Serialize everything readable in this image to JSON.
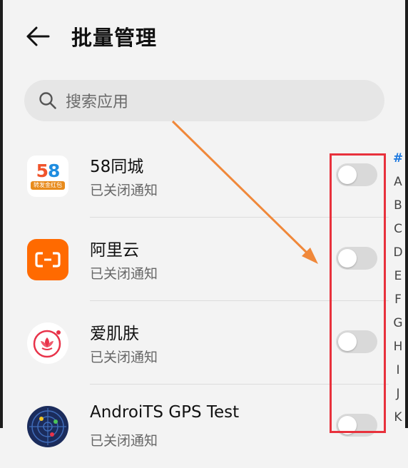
{
  "header": {
    "title": "批量管理",
    "back_icon": "arrow-left-icon"
  },
  "search": {
    "placeholder": "搜索应用",
    "icon": "search-icon"
  },
  "apps": [
    {
      "name": "58同城",
      "status": "已关闭通知",
      "icon": "58-tongcheng-logo",
      "icon_text": "58",
      "icon_tag": "转发金红包",
      "notifications_on": false
    },
    {
      "name": "阿里云",
      "status": "已关闭通知",
      "icon": "aliyun-logo",
      "notifications_on": false
    },
    {
      "name": "爱肌肤",
      "status": "已关闭通知",
      "icon": "aijifu-lotus-logo",
      "notifications_on": false
    },
    {
      "name": "AndroiTS GPS Test",
      "status": "已关闭通知",
      "icon": "gps-radar-logo",
      "notifications_on": false
    }
  ],
  "index_letters": [
    "#",
    "A",
    "B",
    "C",
    "D",
    "E",
    "F",
    "G",
    "H",
    "I",
    "J",
    "K"
  ],
  "active_letter": "#",
  "colors": {
    "accent": "#1f7ae0",
    "highlight_box": "#e8313c",
    "annotation_arrow": "#f0883a",
    "aliyun_orange": "#ff6a00",
    "toggle_off": "#d9d9d9"
  }
}
